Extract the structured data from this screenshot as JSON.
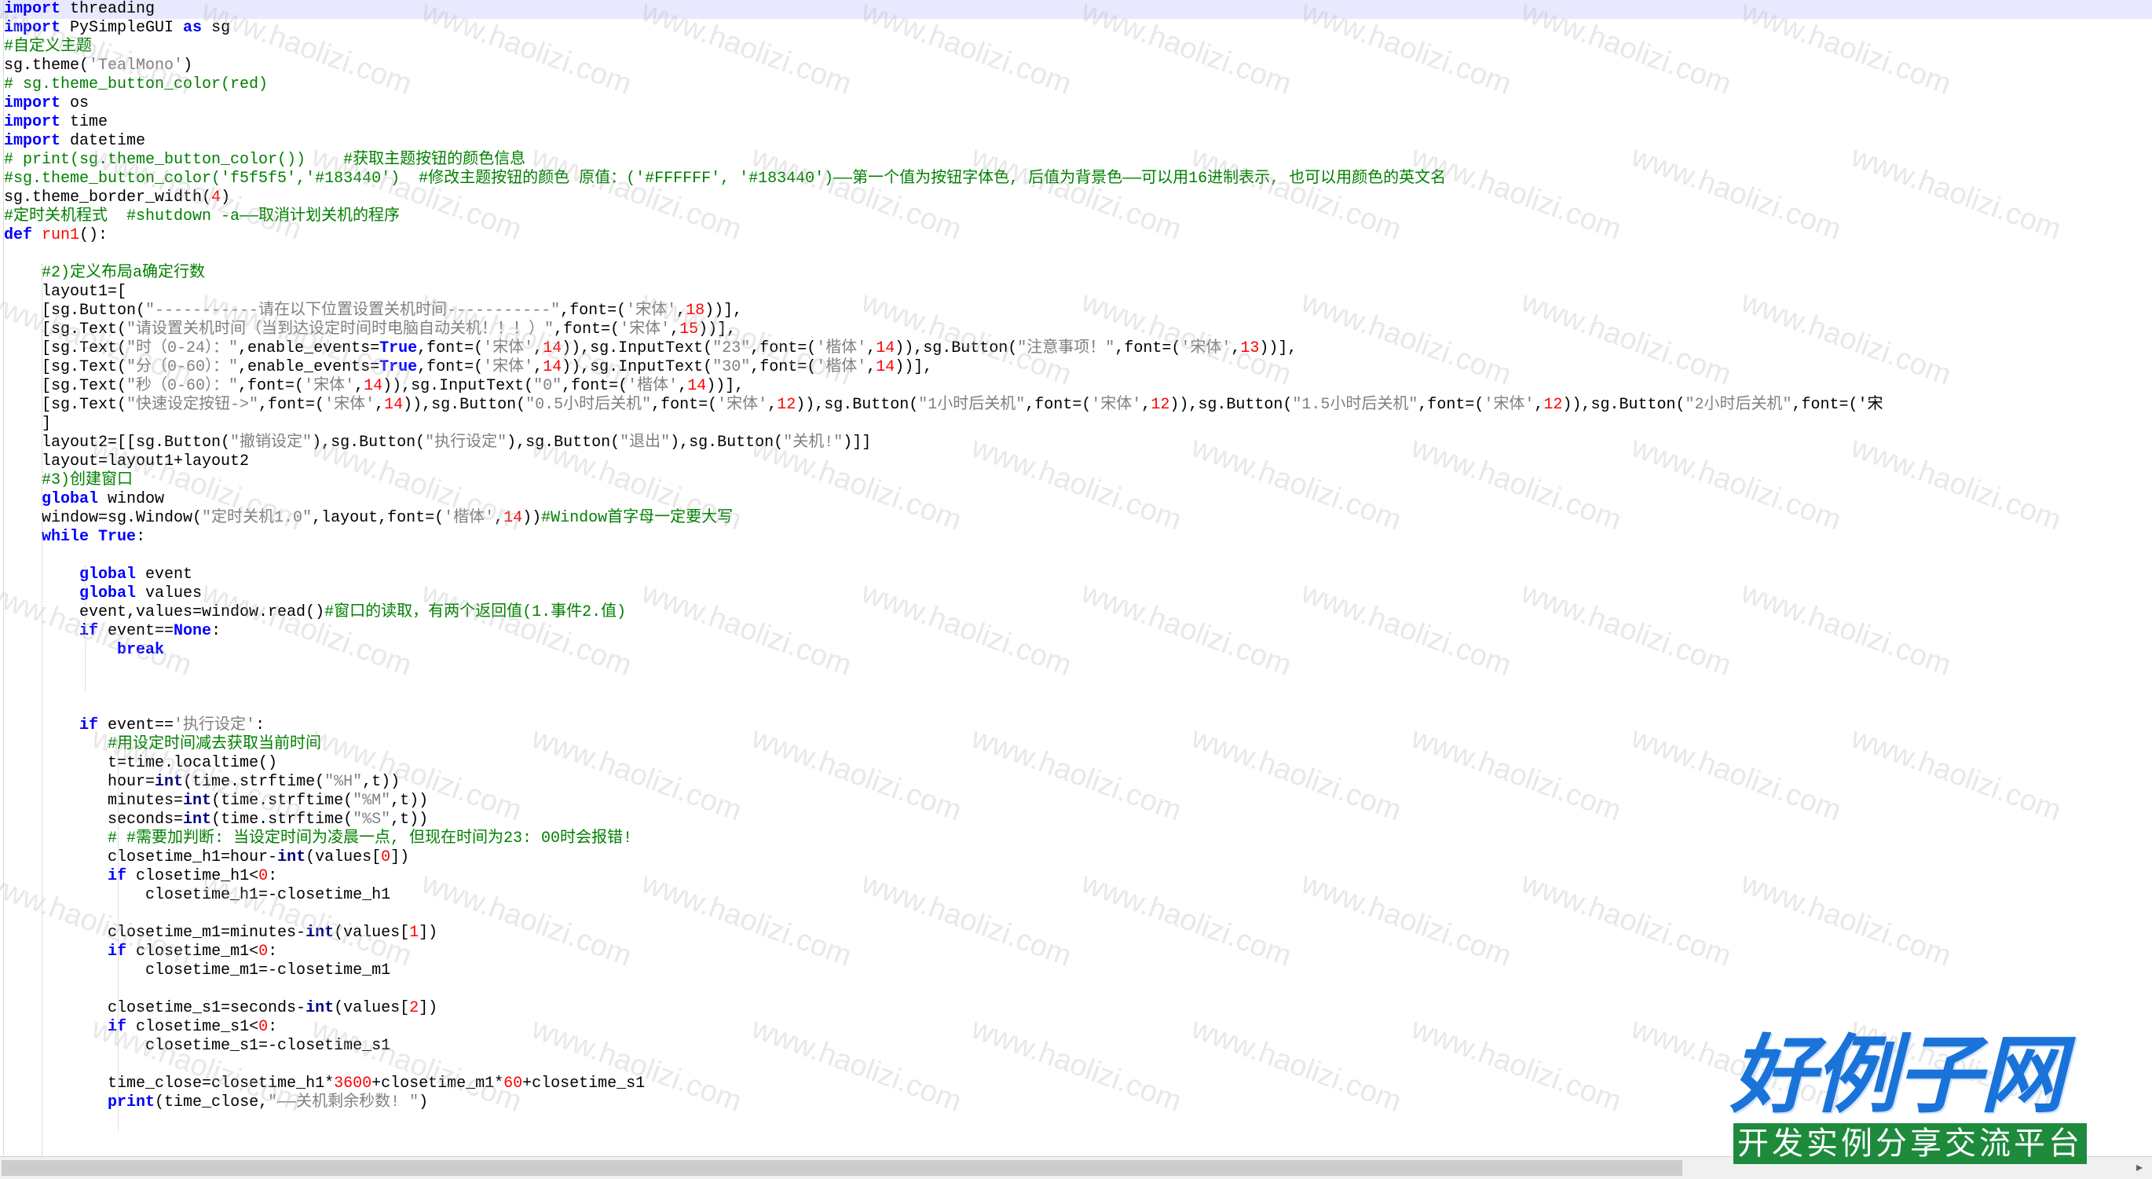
{
  "editor": {
    "lines": [
      [
        {
          "t": "import",
          "c": "kw"
        },
        {
          "t": " threading",
          "c": "pl"
        }
      ],
      [
        {
          "t": "import",
          "c": "kw"
        },
        {
          "t": " PySimpleGUI ",
          "c": "pl"
        },
        {
          "t": "as",
          "c": "kw"
        },
        {
          "t": " sg",
          "c": "pl"
        }
      ],
      [
        {
          "t": "#自定义主题",
          "c": "cm"
        }
      ],
      [
        {
          "t": "sg.theme(",
          "c": "pl"
        },
        {
          "t": "'TealMono'",
          "c": "st"
        },
        {
          "t": ")",
          "c": "pl"
        }
      ],
      [
        {
          "t": "# sg.theme_button_color(red)",
          "c": "cm"
        }
      ],
      [
        {
          "t": "import",
          "c": "kw"
        },
        {
          "t": " os",
          "c": "pl"
        }
      ],
      [
        {
          "t": "import",
          "c": "kw"
        },
        {
          "t": " time",
          "c": "pl"
        }
      ],
      [
        {
          "t": "import",
          "c": "kw"
        },
        {
          "t": " datetime",
          "c": "pl"
        }
      ],
      [
        {
          "t": "# print(sg.theme_button_color())    #获取主题按钮的颜色信息",
          "c": "cm"
        }
      ],
      [
        {
          "t": "#sg.theme_button_color('f5f5f5','#183440')  #修改主题按钮的颜色 原值：('#FFFFFF', '#183440')——第一个值为按钮字体色, 后值为背景色——可以用16进制表示, 也可以用颜色的英文名",
          "c": "cm"
        }
      ],
      [
        {
          "t": "sg.theme_border_width(",
          "c": "pl"
        },
        {
          "t": "4",
          "c": "nm"
        },
        {
          "t": ")",
          "c": "pl"
        }
      ],
      [
        {
          "t": "#定时关机程式  #shutdown -a——取消计划关机的程序",
          "c": "cm"
        }
      ],
      [
        {
          "t": "def",
          "c": "kw"
        },
        {
          "t": " ",
          "c": "pl"
        },
        {
          "t": "run1",
          "c": "nm"
        },
        {
          "t": "():",
          "c": "pl"
        }
      ],
      [
        {
          "t": "",
          "c": "pl"
        }
      ],
      [
        {
          "t": "    #2)定义布局a确定行数",
          "c": "cm"
        }
      ],
      [
        {
          "t": "    layout1=[",
          "c": "pl"
        }
      ],
      [
        {
          "t": "    [sg.Button(",
          "c": "pl"
        },
        {
          "t": "\"-----------请在以下位置设置关机时间-----------\"",
          "c": "st"
        },
        {
          "t": ",font=(",
          "c": "pl"
        },
        {
          "t": "'宋体'",
          "c": "st"
        },
        {
          "t": ",",
          "c": "pl"
        },
        {
          "t": "18",
          "c": "nm"
        },
        {
          "t": "))],",
          "c": "pl"
        }
      ],
      [
        {
          "t": "    [sg.Text(",
          "c": "pl"
        },
        {
          "t": "\"请设置关机时间（当到达设定时间时电脑自动关机！！！）\"",
          "c": "st"
        },
        {
          "t": ",font=(",
          "c": "pl"
        },
        {
          "t": "'宋体'",
          "c": "st"
        },
        {
          "t": ",",
          "c": "pl"
        },
        {
          "t": "15",
          "c": "nm"
        },
        {
          "t": "))],",
          "c": "pl"
        }
      ],
      [
        {
          "t": "    [sg.Text(",
          "c": "pl"
        },
        {
          "t": "\"时（0-24）：\"",
          "c": "st"
        },
        {
          "t": ",enable_events=",
          "c": "pl"
        },
        {
          "t": "True",
          "c": "kw"
        },
        {
          "t": ",font=(",
          "c": "pl"
        },
        {
          "t": "'宋体'",
          "c": "st"
        },
        {
          "t": ",",
          "c": "pl"
        },
        {
          "t": "14",
          "c": "nm"
        },
        {
          "t": ")),sg.InputText(",
          "c": "pl"
        },
        {
          "t": "\"23\"",
          "c": "st"
        },
        {
          "t": ",font=(",
          "c": "pl"
        },
        {
          "t": "'楷体'",
          "c": "st"
        },
        {
          "t": ",",
          "c": "pl"
        },
        {
          "t": "14",
          "c": "nm"
        },
        {
          "t": ")),sg.Button(",
          "c": "pl"
        },
        {
          "t": "\"注意事项！\"",
          "c": "st"
        },
        {
          "t": ",font=(",
          "c": "pl"
        },
        {
          "t": "'宋体'",
          "c": "st"
        },
        {
          "t": ",",
          "c": "pl"
        },
        {
          "t": "13",
          "c": "nm"
        },
        {
          "t": "))],",
          "c": "pl"
        }
      ],
      [
        {
          "t": "    [sg.Text(",
          "c": "pl"
        },
        {
          "t": "\"分（0-60）：\"",
          "c": "st"
        },
        {
          "t": ",enable_events=",
          "c": "pl"
        },
        {
          "t": "True",
          "c": "kw"
        },
        {
          "t": ",font=(",
          "c": "pl"
        },
        {
          "t": "'宋体'",
          "c": "st"
        },
        {
          "t": ",",
          "c": "pl"
        },
        {
          "t": "14",
          "c": "nm"
        },
        {
          "t": ")),sg.InputText(",
          "c": "pl"
        },
        {
          "t": "\"30\"",
          "c": "st"
        },
        {
          "t": ",font=(",
          "c": "pl"
        },
        {
          "t": "'楷体'",
          "c": "st"
        },
        {
          "t": ",",
          "c": "pl"
        },
        {
          "t": "14",
          "c": "nm"
        },
        {
          "t": "))],",
          "c": "pl"
        }
      ],
      [
        {
          "t": "    [sg.Text(",
          "c": "pl"
        },
        {
          "t": "\"秒（0-60）：\"",
          "c": "st"
        },
        {
          "t": ",font=(",
          "c": "pl"
        },
        {
          "t": "'宋体'",
          "c": "st"
        },
        {
          "t": ",",
          "c": "pl"
        },
        {
          "t": "14",
          "c": "nm"
        },
        {
          "t": ")),sg.InputText(",
          "c": "pl"
        },
        {
          "t": "\"0\"",
          "c": "st"
        },
        {
          "t": ",font=(",
          "c": "pl"
        },
        {
          "t": "'楷体'",
          "c": "st"
        },
        {
          "t": ",",
          "c": "pl"
        },
        {
          "t": "14",
          "c": "nm"
        },
        {
          "t": "))],",
          "c": "pl"
        }
      ],
      [
        {
          "t": "    [sg.Text(",
          "c": "pl"
        },
        {
          "t": "\"快速设定按钮->\"",
          "c": "st"
        },
        {
          "t": ",font=(",
          "c": "pl"
        },
        {
          "t": "'宋体'",
          "c": "st"
        },
        {
          "t": ",",
          "c": "pl"
        },
        {
          "t": "14",
          "c": "nm"
        },
        {
          "t": ")),sg.Button(",
          "c": "pl"
        },
        {
          "t": "\"0.5小时后关机\"",
          "c": "st"
        },
        {
          "t": ",font=(",
          "c": "pl"
        },
        {
          "t": "'宋体'",
          "c": "st"
        },
        {
          "t": ",",
          "c": "pl"
        },
        {
          "t": "12",
          "c": "nm"
        },
        {
          "t": ")),sg.Button(",
          "c": "pl"
        },
        {
          "t": "\"1小时后关机\"",
          "c": "st"
        },
        {
          "t": ",font=(",
          "c": "pl"
        },
        {
          "t": "'宋体'",
          "c": "st"
        },
        {
          "t": ",",
          "c": "pl"
        },
        {
          "t": "12",
          "c": "nm"
        },
        {
          "t": ")),sg.Button(",
          "c": "pl"
        },
        {
          "t": "\"1.5小时后关机\"",
          "c": "st"
        },
        {
          "t": ",font=(",
          "c": "pl"
        },
        {
          "t": "'宋体'",
          "c": "st"
        },
        {
          "t": ",",
          "c": "pl"
        },
        {
          "t": "12",
          "c": "nm"
        },
        {
          "t": ")),sg.Button(",
          "c": "pl"
        },
        {
          "t": "\"2小时后关机\"",
          "c": "st"
        },
        {
          "t": ",font=('宋",
          "c": "pl"
        }
      ],
      [
        {
          "t": "    ]",
          "c": "pl"
        }
      ],
      [
        {
          "t": "    layout2=[[sg.Button(",
          "c": "pl"
        },
        {
          "t": "\"撤销设定\"",
          "c": "st"
        },
        {
          "t": "),sg.Button(",
          "c": "pl"
        },
        {
          "t": "\"执行设定\"",
          "c": "st"
        },
        {
          "t": "),sg.Button(",
          "c": "pl"
        },
        {
          "t": "\"退出\"",
          "c": "st"
        },
        {
          "t": "),sg.Button(",
          "c": "pl"
        },
        {
          "t": "\"关机!\"",
          "c": "st"
        },
        {
          "t": ")]]",
          "c": "pl"
        }
      ],
      [
        {
          "t": "    layout=layout1+layout2",
          "c": "pl"
        }
      ],
      [
        {
          "t": "    #3)创建窗口",
          "c": "cm"
        }
      ],
      [
        {
          "t": "    ",
          "c": "pl"
        },
        {
          "t": "global",
          "c": "kw"
        },
        {
          "t": " window",
          "c": "pl"
        }
      ],
      [
        {
          "t": "    window=sg.Window(",
          "c": "pl"
        },
        {
          "t": "\"定时关机1.0\"",
          "c": "st"
        },
        {
          "t": ",layout,font=(",
          "c": "pl"
        },
        {
          "t": "'楷体'",
          "c": "st"
        },
        {
          "t": ",",
          "c": "pl"
        },
        {
          "t": "14",
          "c": "nm"
        },
        {
          "t": "))",
          "c": "pl"
        },
        {
          "t": "#Window首字母一定要大写",
          "c": "cm"
        }
      ],
      [
        {
          "t": "    ",
          "c": "pl"
        },
        {
          "t": "while",
          "c": "kw"
        },
        {
          "t": " ",
          "c": "pl"
        },
        {
          "t": "True",
          "c": "kw"
        },
        {
          "t": ":",
          "c": "pl"
        }
      ],
      [
        {
          "t": "",
          "c": "pl"
        }
      ],
      [
        {
          "t": "        ",
          "c": "pl"
        },
        {
          "t": "global",
          "c": "kw"
        },
        {
          "t": " event",
          "c": "pl"
        }
      ],
      [
        {
          "t": "        ",
          "c": "pl"
        },
        {
          "t": "global",
          "c": "kw"
        },
        {
          "t": " values",
          "c": "pl"
        }
      ],
      [
        {
          "t": "        event,values=window.read()",
          "c": "pl"
        },
        {
          "t": "#窗口的读取，有两个返回值(1.事件2.值)",
          "c": "cm"
        }
      ],
      [
        {
          "t": "        ",
          "c": "pl"
        },
        {
          "t": "if",
          "c": "kw"
        },
        {
          "t": " event==",
          "c": "pl"
        },
        {
          "t": "None",
          "c": "kw"
        },
        {
          "t": ":",
          "c": "pl"
        }
      ],
      [
        {
          "t": "            ",
          "c": "pl"
        },
        {
          "t": "break",
          "c": "kw"
        }
      ],
      [
        {
          "t": "",
          "c": "pl"
        }
      ],
      [
        {
          "t": "",
          "c": "pl"
        }
      ],
      [
        {
          "t": "",
          "c": "pl"
        }
      ],
      [
        {
          "t": "        ",
          "c": "pl"
        },
        {
          "t": "if",
          "c": "kw"
        },
        {
          "t": " event==",
          "c": "pl"
        },
        {
          "t": "'执行设定'",
          "c": "st"
        },
        {
          "t": ":",
          "c": "pl"
        }
      ],
      [
        {
          "t": "           #用设定时间减去获取当前时间",
          "c": "cm"
        }
      ],
      [
        {
          "t": "           t=time.localtime()",
          "c": "pl"
        }
      ],
      [
        {
          "t": "           hour=",
          "c": "pl"
        },
        {
          "t": "int",
          "c": "op"
        },
        {
          "t": "(time.strftime(",
          "c": "pl"
        },
        {
          "t": "\"%H\"",
          "c": "st"
        },
        {
          "t": ",t))",
          "c": "pl"
        }
      ],
      [
        {
          "t": "           minutes=",
          "c": "pl"
        },
        {
          "t": "int",
          "c": "op"
        },
        {
          "t": "(time.strftime(",
          "c": "pl"
        },
        {
          "t": "\"%M\"",
          "c": "st"
        },
        {
          "t": ",t))",
          "c": "pl"
        }
      ],
      [
        {
          "t": "           seconds=",
          "c": "pl"
        },
        {
          "t": "int",
          "c": "op"
        },
        {
          "t": "(time.strftime(",
          "c": "pl"
        },
        {
          "t": "\"%S\"",
          "c": "st"
        },
        {
          "t": ",t))",
          "c": "pl"
        }
      ],
      [
        {
          "t": "           # #需要加判断: 当设定时间为凌晨一点, 但现在时间为23: 00时会报错!",
          "c": "cm"
        }
      ],
      [
        {
          "t": "           closetime_h1=hour-",
          "c": "pl"
        },
        {
          "t": "int",
          "c": "op"
        },
        {
          "t": "(values[",
          "c": "pl"
        },
        {
          "t": "0",
          "c": "nm"
        },
        {
          "t": "])",
          "c": "pl"
        }
      ],
      [
        {
          "t": "           ",
          "c": "pl"
        },
        {
          "t": "if",
          "c": "kw"
        },
        {
          "t": " closetime_h1<",
          "c": "pl"
        },
        {
          "t": "0",
          "c": "nm"
        },
        {
          "t": ":",
          "c": "pl"
        }
      ],
      [
        {
          "t": "               closetime_h1=-closetime_h1",
          "c": "pl"
        }
      ],
      [
        {
          "t": "",
          "c": "pl"
        }
      ],
      [
        {
          "t": "           closetime_m1=minutes-",
          "c": "pl"
        },
        {
          "t": "int",
          "c": "op"
        },
        {
          "t": "(values[",
          "c": "pl"
        },
        {
          "t": "1",
          "c": "nm"
        },
        {
          "t": "])",
          "c": "pl"
        }
      ],
      [
        {
          "t": "           ",
          "c": "pl"
        },
        {
          "t": "if",
          "c": "kw"
        },
        {
          "t": " closetime_m1<",
          "c": "pl"
        },
        {
          "t": "0",
          "c": "nm"
        },
        {
          "t": ":",
          "c": "pl"
        }
      ],
      [
        {
          "t": "               closetime_m1=-closetime_m1",
          "c": "pl"
        }
      ],
      [
        {
          "t": "",
          "c": "pl"
        }
      ],
      [
        {
          "t": "           closetime_s1=seconds-",
          "c": "pl"
        },
        {
          "t": "int",
          "c": "op"
        },
        {
          "t": "(values[",
          "c": "pl"
        },
        {
          "t": "2",
          "c": "nm"
        },
        {
          "t": "])",
          "c": "pl"
        }
      ],
      [
        {
          "t": "           ",
          "c": "pl"
        },
        {
          "t": "if",
          "c": "kw"
        },
        {
          "t": " closetime_s1<",
          "c": "pl"
        },
        {
          "t": "0",
          "c": "nm"
        },
        {
          "t": ":",
          "c": "pl"
        }
      ],
      [
        {
          "t": "               closetime_s1=-closetime_s1",
          "c": "pl"
        }
      ],
      [
        {
          "t": "",
          "c": "pl"
        }
      ],
      [
        {
          "t": "           time_close=closetime_h1*",
          "c": "pl"
        },
        {
          "t": "3600",
          "c": "nm"
        },
        {
          "t": "+closetime_m1*",
          "c": "pl"
        },
        {
          "t": "60",
          "c": "nm"
        },
        {
          "t": "+closetime_s1",
          "c": "pl"
        }
      ],
      [
        {
          "t": "           ",
          "c": "pl"
        },
        {
          "t": "print",
          "c": "kw"
        },
        {
          "t": "(time_close,",
          "c": "pl"
        },
        {
          "t": "\"——关机剩余秒数! \"",
          "c": "st"
        },
        {
          "t": ")",
          "c": "pl"
        }
      ]
    ]
  },
  "watermark": {
    "text": "www.haolizi.com"
  },
  "logo": {
    "title": "好例子网",
    "subtitle": "开发实例分享交流平台"
  },
  "scrollbar": {
    "arrow_icon": "chevron-right-icon"
  },
  "colors": {
    "keyword": "#0000ff",
    "comment": "#008000",
    "string": "#808080",
    "number": "#ff0000",
    "builtin": "#000080",
    "logo_blue": "#1a73d9",
    "logo_green": "#1e8a3c"
  }
}
